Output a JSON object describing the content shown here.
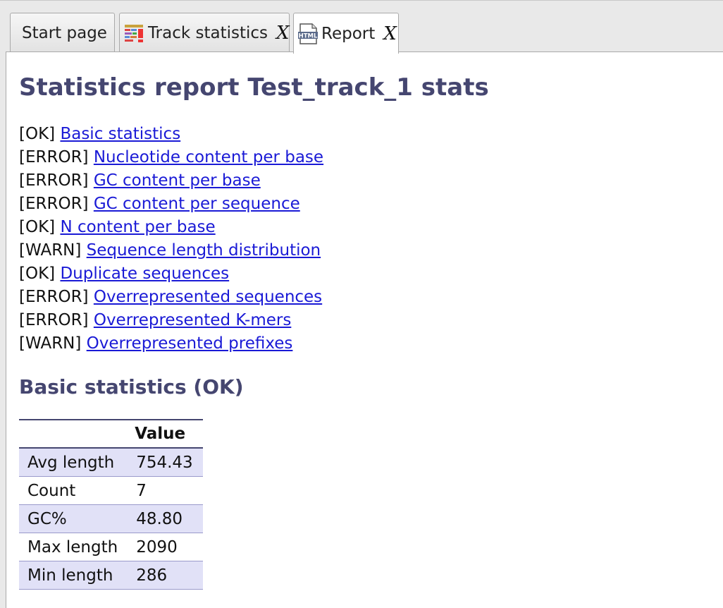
{
  "tabs": [
    {
      "label": "Start page",
      "active": false,
      "closable": false,
      "icon": ""
    },
    {
      "label": "Track statistics",
      "active": false,
      "closable": true,
      "icon": "track-statistics-icon",
      "close_label": "X"
    },
    {
      "label": "Report",
      "active": true,
      "closable": true,
      "icon": "html-file-icon",
      "icon_text": "HTML",
      "close_label": "X"
    }
  ],
  "report": {
    "title": "Statistics report Test_track_1 stats",
    "toc": [
      {
        "status": "[OK]",
        "label": "Basic statistics"
      },
      {
        "status": "[ERROR]",
        "label": "Nucleotide content per base"
      },
      {
        "status": "[ERROR]",
        "label": "GC content per base"
      },
      {
        "status": "[ERROR]",
        "label": "GC content per sequence"
      },
      {
        "status": "[OK]",
        "label": "N content per base"
      },
      {
        "status": "[WARN]",
        "label": "Sequence length distribution"
      },
      {
        "status": "[OK]",
        "label": "Duplicate sequences"
      },
      {
        "status": "[ERROR]",
        "label": "Overrepresented sequences"
      },
      {
        "status": "[ERROR]",
        "label": "Overrepresented K-mers"
      },
      {
        "status": "[WARN]",
        "label": "Overrepresented prefixes"
      }
    ],
    "section_title": "Basic statistics (OK)",
    "table": {
      "headers": [
        "",
        "Value"
      ],
      "rows": [
        [
          "Avg length",
          "754.43"
        ],
        [
          "Count",
          "7"
        ],
        [
          "GC%",
          "48.80"
        ],
        [
          "Max length",
          "2090"
        ],
        [
          "Min length",
          "286"
        ]
      ]
    }
  },
  "colors": {
    "heading": "#454670",
    "link": "#1a1ad6",
    "row_alt": "#e1e1f7"
  }
}
